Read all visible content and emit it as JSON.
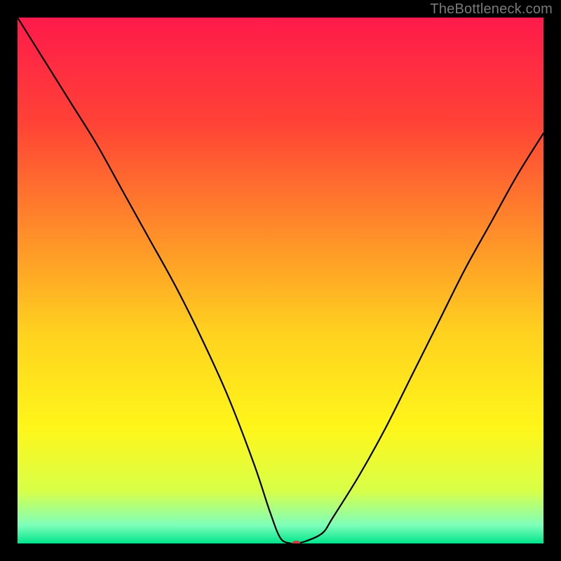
{
  "attribution": "TheBottleneck.com",
  "chart_data": {
    "type": "line",
    "title": "",
    "xlabel": "",
    "ylabel": "",
    "xlim": [
      0,
      100
    ],
    "ylim": [
      0,
      100
    ],
    "grid": false,
    "background_gradient": {
      "stops": [
        {
          "pos": 0.0,
          "color": "#ff1a4b"
        },
        {
          "pos": 0.2,
          "color": "#ff4236"
        },
        {
          "pos": 0.4,
          "color": "#ff8a2a"
        },
        {
          "pos": 0.6,
          "color": "#ffd21f"
        },
        {
          "pos": 0.78,
          "color": "#fff61a"
        },
        {
          "pos": 0.9,
          "color": "#d8ff48"
        },
        {
          "pos": 0.965,
          "color": "#7fffba"
        },
        {
          "pos": 1.0,
          "color": "#00e58c"
        }
      ]
    },
    "series": [
      {
        "name": "bottleneck-curve",
        "stroke": "#000000",
        "stroke_width": 2.2,
        "x": [
          0,
          5,
          10,
          15,
          20,
          25,
          30,
          35,
          40,
          45,
          48,
          50,
          52,
          53,
          55,
          58,
          60,
          65,
          70,
          75,
          80,
          85,
          90,
          95,
          100
        ],
        "y": [
          100,
          92,
          84,
          76,
          67,
          58,
          49,
          39,
          28,
          15,
          6,
          1,
          0,
          0,
          0.5,
          2,
          5,
          13,
          22,
          32,
          42,
          52,
          61,
          70,
          78
        ]
      }
    ],
    "marker": {
      "name": "optimum-marker",
      "x": 53,
      "y": 0,
      "rx": 6,
      "ry": 4,
      "fill": "#d13a3a"
    }
  }
}
